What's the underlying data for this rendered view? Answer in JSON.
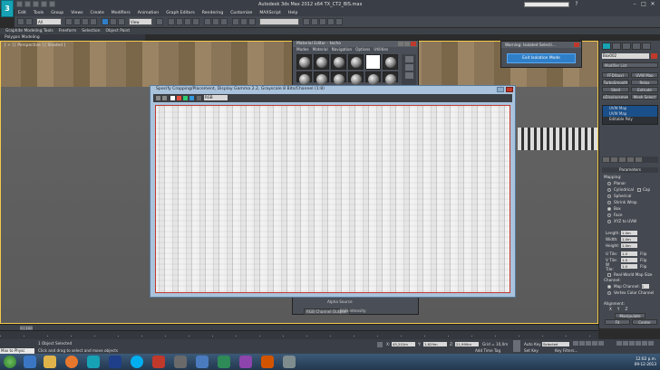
{
  "app": {
    "title": "Autodesk 3ds Max 2012 x64      TX_CT2_BIS.max",
    "logo": "3ds-max-logo",
    "search_placeholder": ""
  },
  "menus": [
    "Edit",
    "Tools",
    "Group",
    "Views",
    "Create",
    "Modifiers",
    "Animation",
    "Graph Editors",
    "Rendering",
    "Customize",
    "MAXScript",
    "Help"
  ],
  "toolbar": {
    "filter_select": "All",
    "view_select": "View",
    "named_selection": ""
  },
  "ribbon": {
    "tabs": [
      "Graphite Modeling Tools",
      "Freeform",
      "Selection",
      "Object Paint"
    ],
    "sub": "Polygon Modeling"
  },
  "viewport": {
    "label": "[ + ] [ Perspective ] [ Shaded ]"
  },
  "material_editor": {
    "title": "Material Editor - techo",
    "menu": [
      "Modes",
      "Material",
      "Navigation",
      "Options",
      "Utilities"
    ],
    "alpha_source": "Alpha Source",
    "rgb_output": "RGB Channel Output:",
    "rgb_intensity": "RGB Intensity"
  },
  "warning": {
    "title": "Warning: Isolated Selecti...",
    "button": "Exit Isolation Mode"
  },
  "bitmap_window": {
    "title": "Specify Cropping/Placement, Display Gamma 2.2, Grayscale 8 Bits/Channel (1:8)",
    "zoom_label": "RGB"
  },
  "right_panel": {
    "object_name": "Box002",
    "modifier_list": "Modifier List",
    "buttons": [
      "FFD(box)",
      "UVW Map",
      "TurboSmooth",
      "Relax",
      "Shell",
      "Extrude",
      "pDisplacement",
      "Mesh Select"
    ],
    "stack": [
      "UVW Map",
      "UVW Map",
      "Editable Poly"
    ],
    "parameters_title": "Parameters",
    "mapping_title": "Mapping:",
    "mapping_options": [
      {
        "label": "Planar",
        "on": false
      },
      {
        "label": "Cylindrical",
        "on": false
      },
      {
        "label": "Spherical",
        "on": false
      },
      {
        "label": "Shrink Wrap",
        "on": false
      },
      {
        "label": "Box",
        "on": true
      },
      {
        "label": "Face",
        "on": false
      },
      {
        "label": "XYZ to UVW",
        "on": false
      }
    ],
    "cap_label": "Cap",
    "dims": [
      {
        "label": "Length:",
        "value": "1.0m"
      },
      {
        "label": "Width:",
        "value": "1.0m"
      },
      {
        "label": "Height:",
        "value": "1.0m"
      }
    ],
    "tiles": [
      {
        "label": "U Tile:",
        "value": "1.0"
      },
      {
        "label": "V Tile:",
        "value": "1.0"
      },
      {
        "label": "W Tile:",
        "value": "1.0"
      }
    ],
    "flip_label": "Flip",
    "real_world": "Real-World Map Size",
    "channel_title": "Channel:",
    "map_channel": "Map Channel:",
    "map_channel_value": "1",
    "vertex_color": "Vertex Color Channel",
    "alignment_title": "Alignment:",
    "axes": [
      "X",
      "Y",
      "Z"
    ],
    "manipulate": "Manipulate",
    "fit_btn": "Fit",
    "center_btn": "Center"
  },
  "timeline": {
    "position": "0 / 100"
  },
  "status": {
    "selection": "1 Object Selected",
    "prompt": "Click and drag to select and move objects",
    "maxscript": "Max to Physc",
    "x_label": "X:",
    "x_value": "45,201m",
    "y_label": "Y:",
    "y_value": "1,629m",
    "z_label": "Z:",
    "z_value": "21,990m",
    "grid": "Grid = 10,0m",
    "add_time_tag": "Add Time Tag",
    "auto_key": "Auto Key",
    "selected": "Selected",
    "set_key": "Set Key",
    "key_filters": "Key Filters..."
  },
  "taskbar": {
    "time": "12:02 p.m.",
    "date": "09-12-2013"
  }
}
